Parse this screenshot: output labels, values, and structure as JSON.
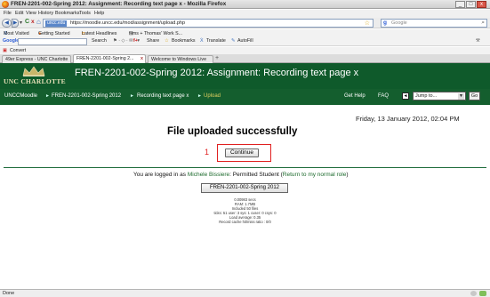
{
  "window": {
    "title": "FREN-2201-002-Spring 2012: Assignment: Recording text page x - Mozilla Firefox",
    "minimize": "_",
    "maximize": "□",
    "close": "x"
  },
  "menubar": {
    "items": [
      "File",
      "Edit",
      "View",
      "History",
      "Bookmarks",
      "Tools",
      "Help"
    ]
  },
  "navbar": {
    "back": "◀",
    "forward": "▶",
    "dropdown": "▾",
    "refresh": "C",
    "stop": "x",
    "home": "⌂",
    "site_label": "uncc.edu",
    "url": "https://moodle.uncc.edu/mod/assignment/upload.php",
    "search_engine": "g",
    "search_placeholder": "Google"
  },
  "bookmarks": {
    "items": [
      "Most Visited",
      "Getting Started",
      "Latest Headlines",
      "films + Thomas' Work S..."
    ]
  },
  "google_toolbar": {
    "label": "Google",
    "search": "Search",
    "items": [
      "Share",
      "Bookmarks",
      "Translate",
      "AutoFill"
    ]
  },
  "convert_bar": {
    "label": "Convert"
  },
  "tabs": [
    {
      "label": "49er Express - UNC Charlotte",
      "active": false
    },
    {
      "label": "FREN-2201-002-Spring 2...",
      "active": true
    },
    {
      "label": "Welcome to Windows Live",
      "active": false
    }
  ],
  "new_tab": "+",
  "header": {
    "logo_text": "UNC CHARLOTTE",
    "page_heading": "FREN-2201-002-Spring 2012: Assignment: Recording text page x"
  },
  "breadcrumb": {
    "items": [
      "UNCCMoodle",
      "FREN-2201-002-Spring 2012",
      "Recording text page x",
      "Upload"
    ],
    "separator": "►"
  },
  "nav_links": {
    "help": "Get Help",
    "faq": "FAQ"
  },
  "jump": {
    "back_label": "◄",
    "select_value": "Jump to...",
    "go_label": "Go"
  },
  "content": {
    "datetime": "Friday, 13 January 2012, 02:04 PM",
    "message": "File uploaded successfully",
    "annotation_number": "1",
    "continue_label": "Continue",
    "login_prefix": "You are logged in as",
    "user_name": "Michele Bissiere",
    "login_role": ": Permitted Student (",
    "return_link": "Return to my normal role",
    "login_suffix": ")",
    "course_button": "FREN-2201-002-Spring 2012",
    "perf": [
      "0.00983 secs",
      "RAM: 1.7MB",
      "Included 50 files",
      "ticks: 51 user: 3 sys: 1 cuser: 0 csys: 0",
      "Load average: 0.35",
      "Record cache hit/miss ratio : 0/0"
    ]
  },
  "statusbar": {
    "text": "Done"
  },
  "colors": {
    "moodle_green": "#0f5a2b",
    "annotation_red": "#e02020",
    "link_green": "#1c6a2c"
  }
}
